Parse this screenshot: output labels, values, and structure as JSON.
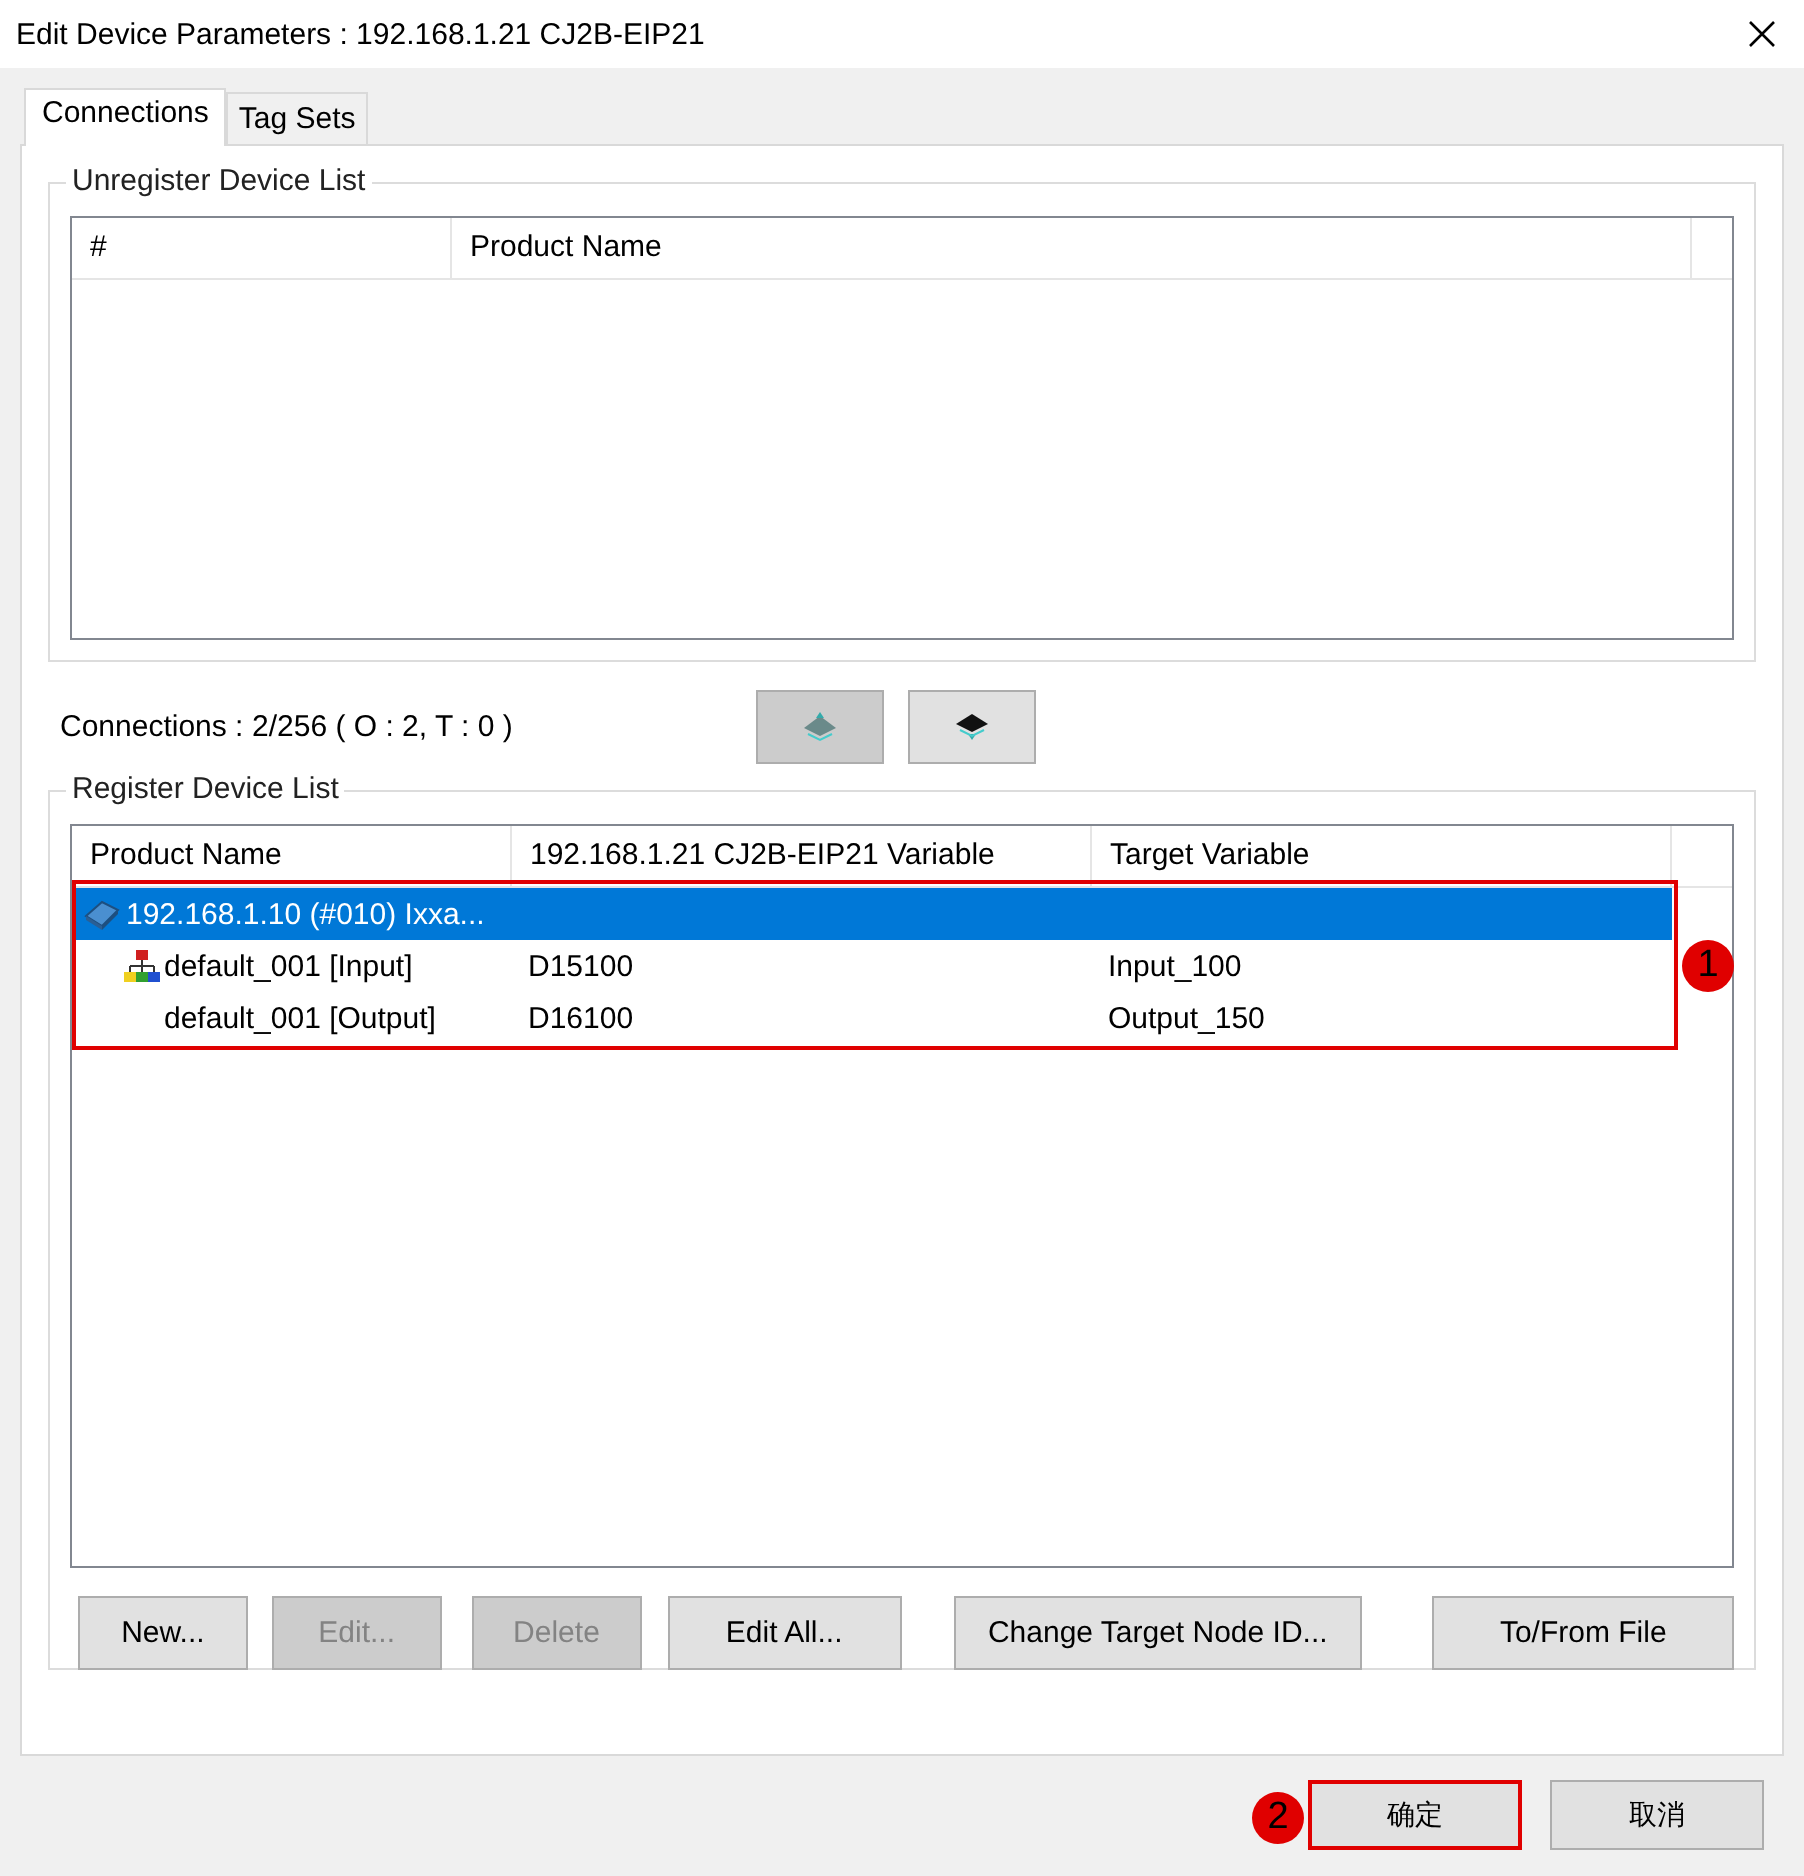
{
  "window": {
    "title": "Edit Device Parameters : 192.168.1.21 CJ2B-EIP21"
  },
  "tabs": [
    {
      "label": "Connections",
      "selected": true
    },
    {
      "label": "Tag Sets",
      "selected": false
    }
  ],
  "unregister_list": {
    "title": "Unregister Device List",
    "columns": [
      "#",
      "Product Name"
    ]
  },
  "connections": {
    "label": "Connections :",
    "value": "2/256 ( O : 2, T : 0 )"
  },
  "register_list": {
    "title": "Register Device List",
    "columns": [
      "Product Name",
      "192.168.1.21 CJ2B-EIP21 Variable",
      "Target Variable"
    ],
    "rows": [
      {
        "kind": "device",
        "product": "192.168.1.10 (#010) Ixxa...",
        "selected": true,
        "children": [
          {
            "kind": "tagset",
            "product": "default_001 [Input]",
            "variable": "D15100",
            "target": "Input_100",
            "selected": false
          },
          {
            "kind": "plain",
            "product": "default_001 [Output]",
            "variable": "D16100",
            "target": "Output_150",
            "selected": false
          }
        ]
      }
    ]
  },
  "list_buttons": [
    {
      "label": "New...",
      "disabled": false
    },
    {
      "label": "Edit...",
      "disabled": true
    },
    {
      "label": "Delete",
      "disabled": true
    },
    {
      "label": "Edit All...",
      "disabled": false
    },
    {
      "label": "Change Target Node ID...",
      "disabled": false
    },
    {
      "label": "To/From File",
      "disabled": false
    }
  ],
  "dialog_buttons": [
    {
      "label": "确定",
      "highlighted": true
    },
    {
      "label": "取消",
      "highlighted": false
    }
  ],
  "annotations": [
    {
      "label": "1"
    },
    {
      "label": "2"
    }
  ]
}
